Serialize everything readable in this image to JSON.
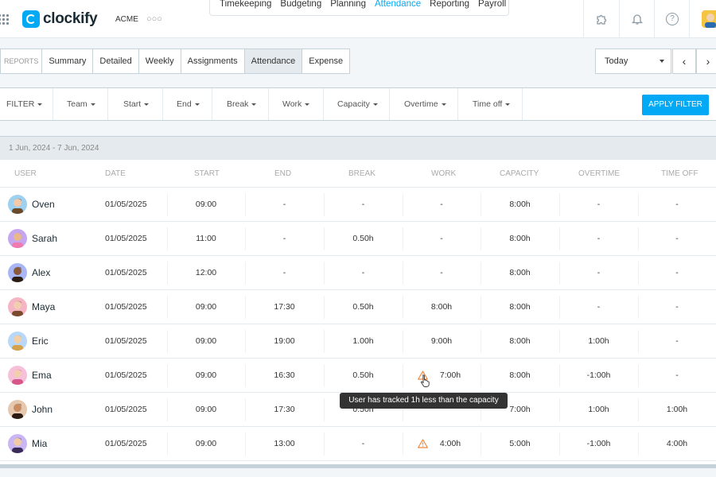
{
  "header": {
    "app_name": "clockify",
    "workspace": "ACME",
    "nav": [
      "Timekeeping",
      "Budgeting",
      "Planning",
      "Attendance",
      "Reporting",
      "Payroll"
    ],
    "active_nav": "Attendance"
  },
  "reports": {
    "label": "REPORTS",
    "tabs": [
      "Summary",
      "Detailed",
      "Weekly",
      "Assignments",
      "Attendance",
      "Expense"
    ],
    "active_tab": "Attendance",
    "date_picker": "Today"
  },
  "filters": {
    "label": "FILTER",
    "items": [
      "Team",
      "Start",
      "End",
      "Break",
      "Work",
      "Capacity",
      "Overtime",
      "Time off"
    ],
    "apply_label": "APPLY FILTER"
  },
  "table": {
    "date_range": "1 Jun, 2024 - 7 Jun, 2024",
    "columns": [
      "USER",
      "DATE",
      "START",
      "END",
      "BREAK",
      "WORK",
      "CAPACITY",
      "OVERTIME",
      "TIME OFF"
    ],
    "rows": [
      {
        "user": "Oven",
        "date": "01/05/2025",
        "start": "09:00",
        "end": "-",
        "break": "-",
        "work": "-",
        "capacity": "8:00h",
        "overtime": "-",
        "timeoff": "-",
        "warning": false
      },
      {
        "user": "Sarah",
        "date": "01/05/2025",
        "start": "11:00",
        "end": "-",
        "break": "0.50h",
        "work": "-",
        "capacity": "8:00h",
        "overtime": "-",
        "timeoff": "-",
        "warning": false
      },
      {
        "user": "Alex",
        "date": "01/05/2025",
        "start": "12:00",
        "end": "-",
        "break": "-",
        "work": "-",
        "capacity": "8:00h",
        "overtime": "-",
        "timeoff": "-",
        "warning": false
      },
      {
        "user": "Maya",
        "date": "01/05/2025",
        "start": "09:00",
        "end": "17:30",
        "break": "0.50h",
        "work": "8:00h",
        "capacity": "8:00h",
        "overtime": "-",
        "timeoff": "-",
        "warning": false
      },
      {
        "user": "Eric",
        "date": "01/05/2025",
        "start": "09:00",
        "end": "19:00",
        "break": "1.00h",
        "work": "9:00h",
        "capacity": "8:00h",
        "overtime": "1:00h",
        "timeoff": "-",
        "warning": false
      },
      {
        "user": "Ema",
        "date": "01/05/2025",
        "start": "09:00",
        "end": "16:30",
        "break": "0.50h",
        "work": "7:00h",
        "capacity": "8:00h",
        "overtime": "-1:00h",
        "timeoff": "-",
        "warning": true
      },
      {
        "user": "John",
        "date": "01/05/2025",
        "start": "09:00",
        "end": "17:30",
        "break": "0.50h",
        "work": "",
        "capacity": "7:00h",
        "overtime": "1:00h",
        "timeoff": "1:00h",
        "warning": false
      },
      {
        "user": "Mia",
        "date": "01/05/2025",
        "start": "09:00",
        "end": "13:00",
        "break": "-",
        "work": "4:00h",
        "capacity": "5:00h",
        "overtime": "-1:00h",
        "timeoff": "4:00h",
        "warning": true
      }
    ]
  },
  "tooltip": "User has tracked 1h less than the capacity",
  "colors": {
    "accent": "#03a9f4",
    "warning": "#f0883e"
  }
}
